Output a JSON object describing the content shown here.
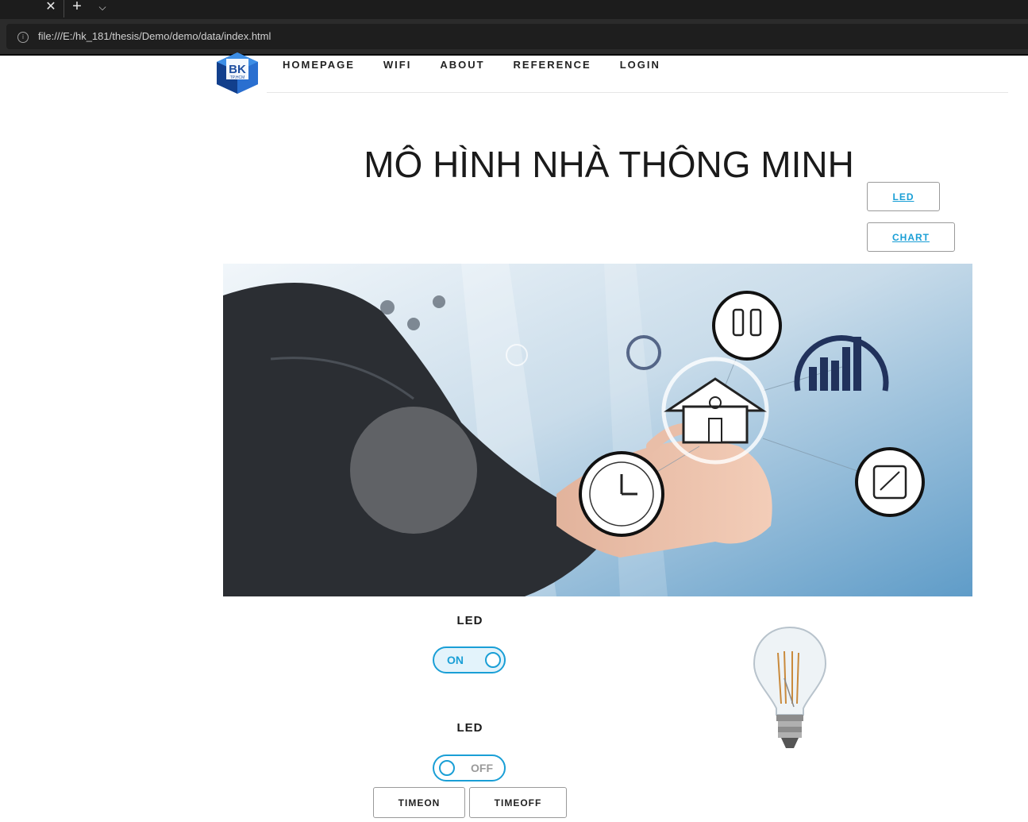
{
  "browser": {
    "url": "file:///E:/hk_181/thesis/Demo/demo/data/index.html",
    "tab_close_icon": "close-icon",
    "new_tab_icon": "plus-icon",
    "tab_list_icon": "chevron-down-icon",
    "info_icon": "info-icon"
  },
  "logo": {
    "text": "BK",
    "subtext": "TP.HCM"
  },
  "nav": {
    "items": [
      "HOMEPAGE",
      "WIFI",
      "ABOUT",
      "REFERENCE",
      "LOGIN"
    ]
  },
  "page": {
    "title": "MÔ HÌNH NHÀ THÔNG MINH"
  },
  "side_buttons": {
    "led": "LED",
    "chart": "CHART"
  },
  "controls": {
    "led1": {
      "label": "LED",
      "state": "ON"
    },
    "led2": {
      "label": "LED",
      "state": "OFF"
    },
    "timeon": "TIMEON",
    "timeoff": "TIMEOFF"
  },
  "colors": {
    "accent": "#1a9fd6",
    "logo_blue": "#1f5bb4",
    "toggle_on_bg": "#e3f3fb"
  }
}
